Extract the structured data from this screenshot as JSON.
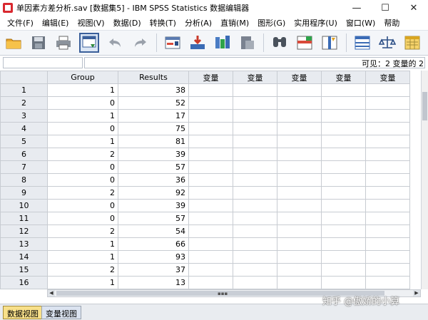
{
  "window": {
    "title": "单因素方差分析.sav [数据集5] - IBM SPSS Statistics 数据编辑器",
    "controls": [
      "—",
      "☐",
      "✕"
    ]
  },
  "menubar": {
    "items": [
      "文件(F)",
      "编辑(E)",
      "视图(V)",
      "数据(D)",
      "转换(T)",
      "分析(A)",
      "直销(M)",
      "图形(G)",
      "实用程序(U)",
      "窗口(W)",
      "帮助"
    ]
  },
  "toolbar": {
    "buttons": [
      {
        "icon": "open-folder-icon"
      },
      {
        "icon": "save-icon"
      },
      {
        "icon": "print-icon"
      },
      {
        "icon": "recall-dialog-icon"
      },
      {
        "icon": "undo-icon"
      },
      {
        "icon": "redo-icon"
      },
      {
        "icon": "goto-case-icon"
      },
      {
        "icon": "goto-variable-icon"
      },
      {
        "icon": "variables-icon"
      },
      {
        "icon": "run-descriptives-icon"
      },
      {
        "icon": "find-icon"
      },
      {
        "icon": "insert-cases-icon"
      },
      {
        "icon": "insert-variable-icon"
      },
      {
        "icon": "split-file-icon"
      },
      {
        "icon": "weight-cases-icon"
      },
      {
        "icon": "select-cases-icon"
      }
    ],
    "accent": "#3a5f9a"
  },
  "cellbar": {
    "cell_ref": "",
    "cell_value": "",
    "visible": "可见：2 变量的 2"
  },
  "grid": {
    "columns": [
      "Group",
      "Results",
      "变量",
      "变量",
      "变量",
      "变量",
      "变量"
    ],
    "rows": [
      {
        "n": "1",
        "group": "1",
        "results": "38"
      },
      {
        "n": "2",
        "group": "0",
        "results": "52"
      },
      {
        "n": "3",
        "group": "1",
        "results": "17"
      },
      {
        "n": "4",
        "group": "0",
        "results": "75"
      },
      {
        "n": "5",
        "group": "1",
        "results": "81"
      },
      {
        "n": "6",
        "group": "2",
        "results": "39"
      },
      {
        "n": "7",
        "group": "0",
        "results": "57"
      },
      {
        "n": "8",
        "group": "0",
        "results": "36"
      },
      {
        "n": "9",
        "group": "2",
        "results": "92"
      },
      {
        "n": "10",
        "group": "0",
        "results": "39"
      },
      {
        "n": "11",
        "group": "0",
        "results": "57"
      },
      {
        "n": "12",
        "group": "2",
        "results": "54"
      },
      {
        "n": "13",
        "group": "1",
        "results": "66"
      },
      {
        "n": "14",
        "group": "1",
        "results": "93"
      },
      {
        "n": "15",
        "group": "2",
        "results": "37"
      },
      {
        "n": "16",
        "group": "1",
        "results": "13"
      }
    ]
  },
  "tabs": {
    "data_view": "数据视图",
    "variable_view": "变量视图"
  },
  "watermark": "知乎 @傲娇的小算"
}
